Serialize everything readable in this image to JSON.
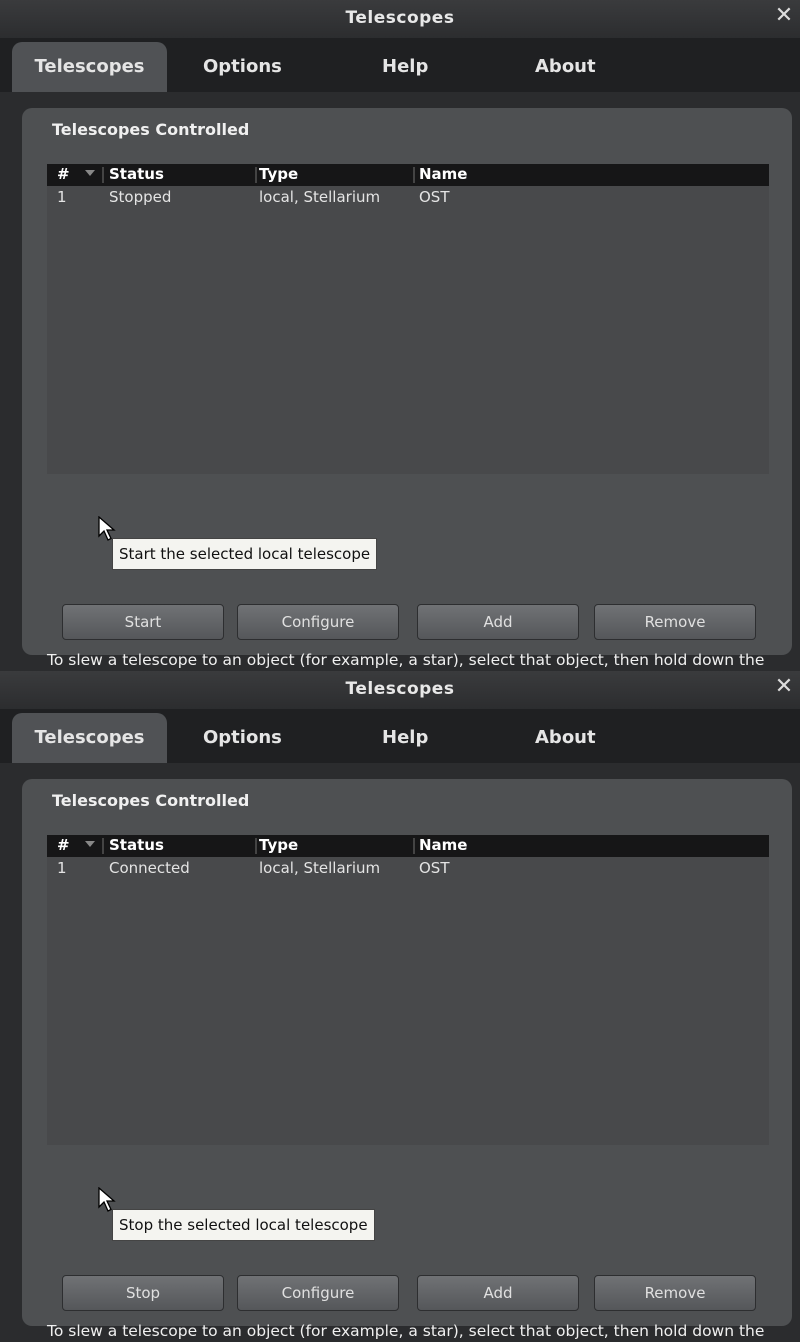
{
  "windows": [
    {
      "title": "Telescopes",
      "tabs": [
        "Telescopes",
        "Options",
        "Help",
        "About"
      ],
      "section_title": "Telescopes Controlled",
      "columns": [
        "#",
        "Status",
        "Type",
        "Name"
      ],
      "rows": [
        {
          "num": "1",
          "status": "Stopped",
          "type": "local, Stellarium",
          "name": "OST"
        }
      ],
      "buttons": {
        "start_stop": "Start",
        "configure": "Configure",
        "add": "Add",
        "remove": "Remove"
      },
      "help_text": "To slew a telescope to an object (for example, a star), select that object, then hold down the Ctrl key and press the key with that telescope's number. To slew it to the center of the current view, hold down the Alt key and press the key with that telescope's number.",
      "tooltip": "Start the selected local telescope"
    },
    {
      "title": "Telescopes",
      "tabs": [
        "Telescopes",
        "Options",
        "Help",
        "About"
      ],
      "section_title": "Telescopes Controlled",
      "columns": [
        "#",
        "Status",
        "Type",
        "Name"
      ],
      "rows": [
        {
          "num": "1",
          "status": "Connected",
          "type": "local, Stellarium",
          "name": "OST"
        }
      ],
      "buttons": {
        "start_stop": "Stop",
        "configure": "Configure",
        "add": "Add",
        "remove": "Remove"
      },
      "help_text": "To slew a telescope to an object (for example, a star), select that object, then hold down the Ctrl key and press the key with that telescope's number. To slew it to the center of the current view, hold down the Alt key and press the key with that telescope's number.",
      "tooltip": "Stop the selected local telescope"
    }
  ],
  "icons": {
    "close": "close-icon",
    "sort": "sort-arrow-icon",
    "cursor": "mouse-pointer-icon"
  },
  "colors": {
    "header_bg": "#161617",
    "panel_bg": "#4e5052",
    "tooltip_bg": "#f4f4f0"
  }
}
